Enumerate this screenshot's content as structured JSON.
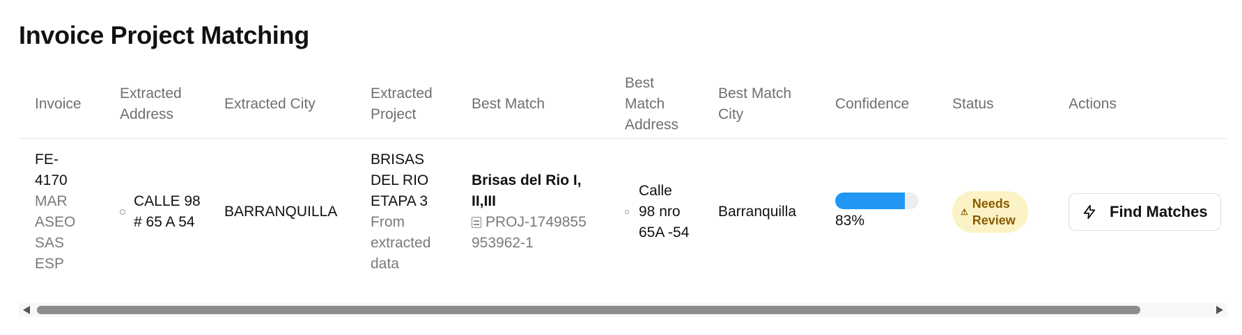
{
  "page": {
    "title": "Invoice Project Matching"
  },
  "table": {
    "headers": {
      "invoice": "Invoice",
      "extracted_address": "Extracted Address",
      "extracted_city": "Extracted City",
      "extracted_project": "Extracted Project",
      "best_match": "Best Match",
      "best_match_address": "Best Match Address",
      "best_match_city": "Best Match City",
      "confidence": "Confidence",
      "status": "Status",
      "actions": "Actions"
    },
    "rows": [
      {
        "invoice_id": "FE-4170",
        "vendor": "MAR ASEO SAS ESP",
        "extracted_address": "CALLE 98 # 65 A 54",
        "extracted_city": "BARRANQUILLA",
        "extracted_project": "BRISAS DEL RIO ETAPA 3",
        "extracted_project_note": "From extracted data",
        "best_match_name": "Brisas del Rio I, II,III",
        "best_match_id": "PROJ-1749855953962-1",
        "best_match_address": "Calle 98 nro 65A -54",
        "best_match_city": "Barranquilla",
        "confidence_value": 0.83,
        "confidence_label": "83%",
        "status": "Needs Review",
        "action_label": "Find Matches"
      }
    ]
  },
  "colors": {
    "accent": "#2196f3",
    "badge_bg": "#fbf3c5",
    "badge_text": "#8a5a00"
  },
  "icons": {
    "address": "map-pin-icon",
    "project": "building-icon",
    "status": "warning-icon",
    "action": "bolt-icon"
  }
}
